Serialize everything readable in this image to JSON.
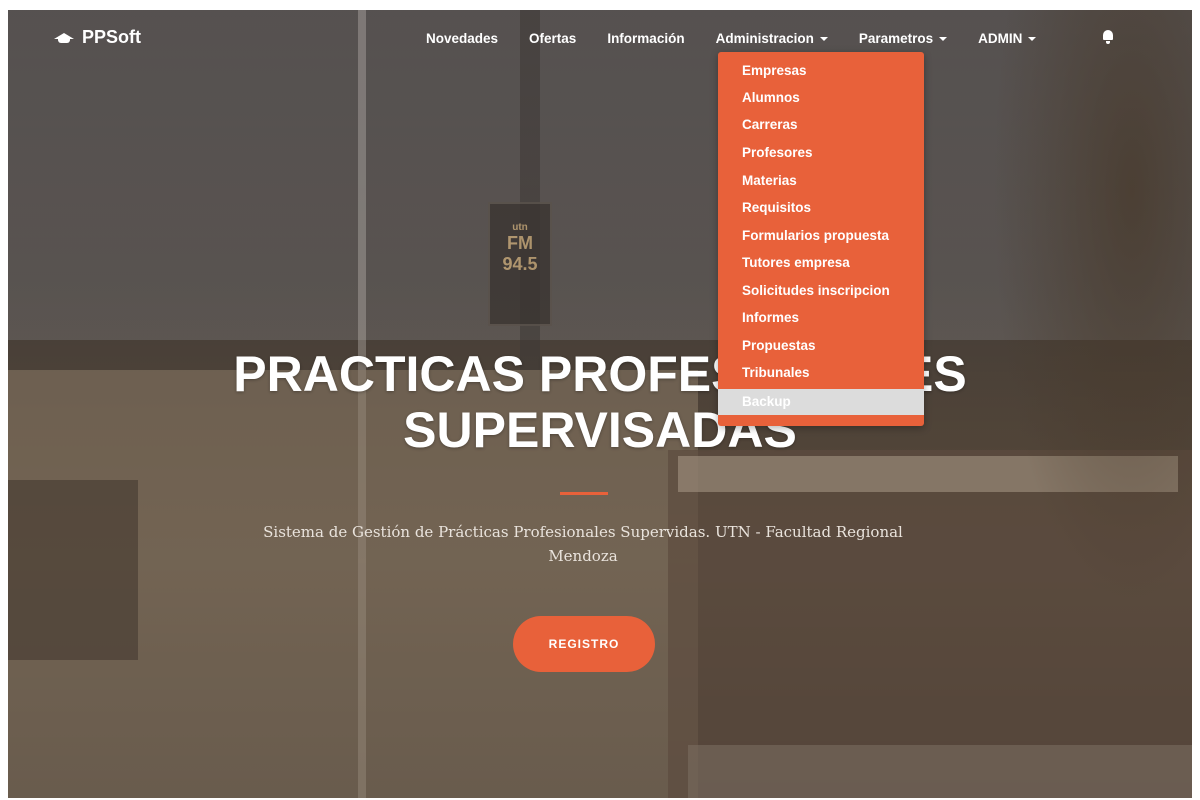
{
  "brand": {
    "name": "PPSoft",
    "icon": "graduation-cap-icon"
  },
  "nav": {
    "items": [
      "Novedades",
      "Ofertas",
      "Información",
      "Administracion",
      "Parametros",
      "ADMIN"
    ],
    "bell_icon": "bell-icon"
  },
  "dropdown": {
    "items": [
      "Empresas",
      "Alumnos",
      "Carreras",
      "Profesores",
      "Materias",
      "Requisitos",
      "Formularios propuesta",
      "Tutores empresa",
      "Solicitudes inscripcion",
      "Informes",
      "Propuestas",
      "Tribunales",
      "Backup"
    ],
    "highlighted": "Backup"
  },
  "hero": {
    "title_line1": "PRACTICAS PROFESIONALES",
    "title_line2": "SUPERVISADAS",
    "subtitle": "Sistema de Gestión de Prácticas Profesionales Supervidas. UTN - Facultad Regional Mendoza",
    "button": "REGISTRO"
  },
  "colors": {
    "accent": "#e8613a",
    "highlight": "#dcdcdc",
    "text": "#ffffff"
  }
}
